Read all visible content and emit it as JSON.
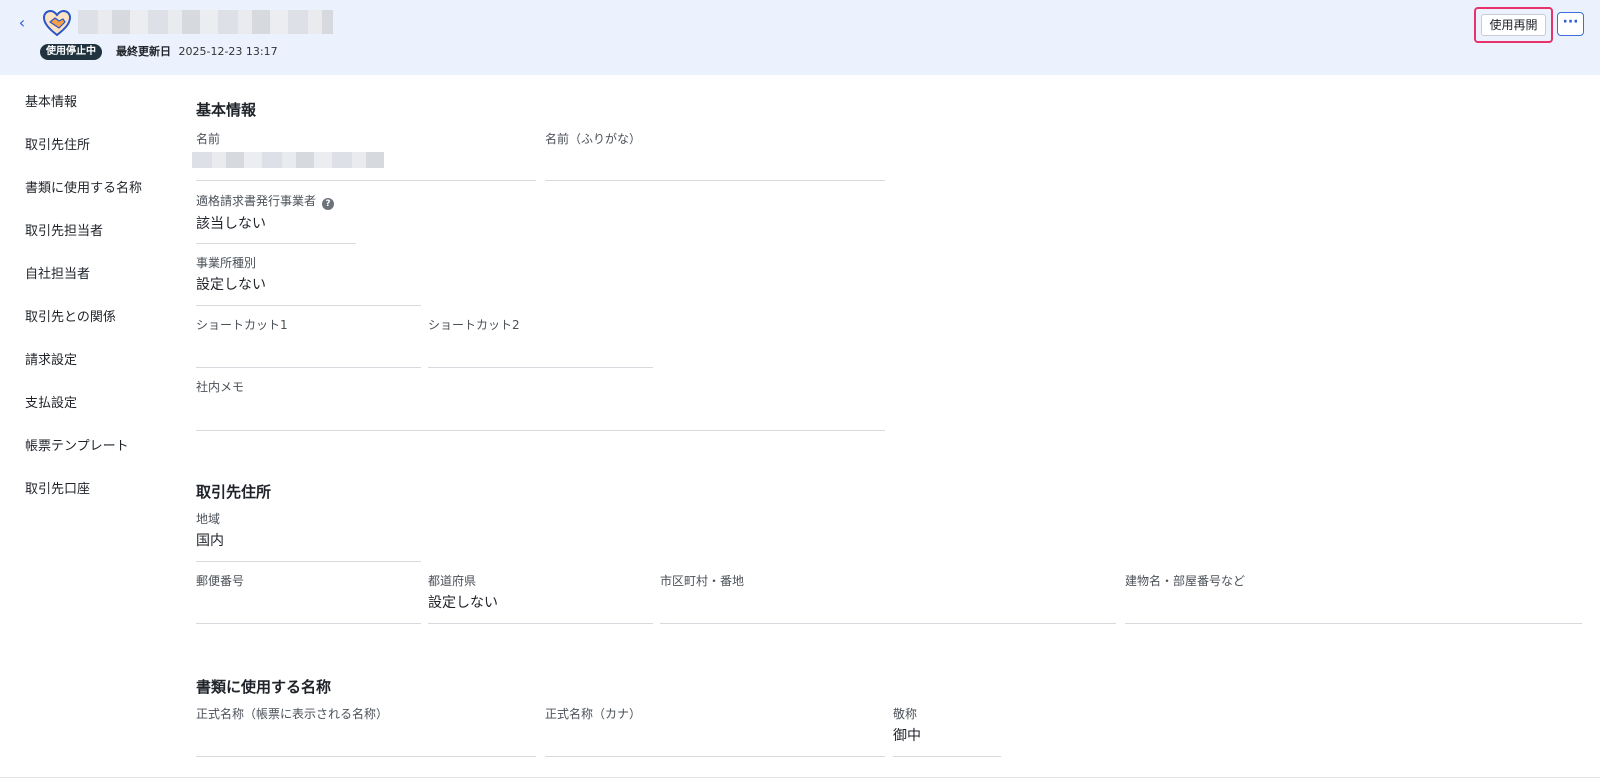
{
  "header": {
    "status_badge": "使用停止中",
    "updated_label": "最終更新日",
    "updated_value": "2025-12-23 13:17",
    "resume_button": "使用再開",
    "more_button": "···"
  },
  "sidebar": {
    "items": [
      "基本情報",
      "取引先住所",
      "書類に使用する名称",
      "取引先担当者",
      "自社担当者",
      "取引先との関係",
      "請求設定",
      "支払設定",
      "帳票テンプレート",
      "取引先口座"
    ]
  },
  "basic_info": {
    "title": "基本情報",
    "name_label": "名前",
    "name_kana_label": "名前（ふりがな）",
    "qualified_invoice_label": "適格請求書発行事業者",
    "qualified_invoice_value": "該当しない",
    "office_type_label": "事業所種別",
    "office_type_value": "設定しない",
    "shortcut1_label": "ショートカット1",
    "shortcut2_label": "ショートカット2",
    "memo_label": "社内メモ"
  },
  "address": {
    "title": "取引先住所",
    "region_label": "地域",
    "region_value": "国内",
    "postal_label": "郵便番号",
    "prefecture_label": "都道府県",
    "prefecture_value": "設定しない",
    "city_label": "市区町村・番地",
    "building_label": "建物名・部屋番号など"
  },
  "doc_names": {
    "title": "書類に使用する名称",
    "official_label": "正式名称（帳票に表示される名称）",
    "official_kana_label": "正式名称（カナ）",
    "honorific_label": "敬称",
    "honorific_value": "御中"
  },
  "colors": {
    "header_bg": "#ecf2fd",
    "accent": "#2c5bd6",
    "highlight": "#e8326a",
    "badge_bg": "#21333e"
  }
}
